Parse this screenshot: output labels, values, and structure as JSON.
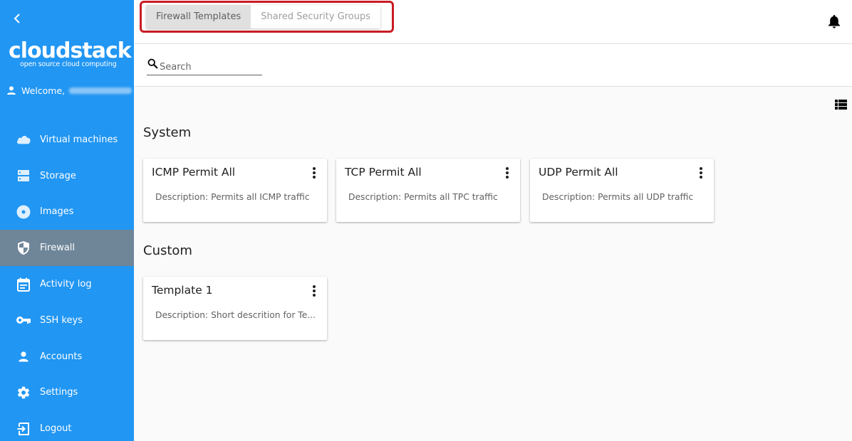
{
  "sidebar": {
    "logo": {
      "name": "cloudstack",
      "tagline": "open source cloud computing"
    },
    "welcome_label": "Welcome,",
    "items": [
      {
        "label": "Virtual machines",
        "icon": "cloud-icon",
        "active": false
      },
      {
        "label": "Storage",
        "icon": "storage-icon",
        "active": false
      },
      {
        "label": "Images",
        "icon": "disc-icon",
        "active": false
      },
      {
        "label": "Firewall",
        "icon": "shield-icon",
        "active": true
      },
      {
        "label": "Activity log",
        "icon": "calendar-icon",
        "active": false
      },
      {
        "label": "SSH keys",
        "icon": "key-icon",
        "active": false
      },
      {
        "label": "Accounts",
        "icon": "person-icon",
        "active": false
      },
      {
        "label": "Settings",
        "icon": "gear-icon",
        "active": false
      },
      {
        "label": "Logout",
        "icon": "logout-icon",
        "active": false
      }
    ]
  },
  "header": {
    "tabs": [
      {
        "label": "Firewall Templates",
        "active": true
      },
      {
        "label": "Shared Security Groups",
        "active": false
      }
    ]
  },
  "search": {
    "placeholder": "Search",
    "value": ""
  },
  "sections": [
    {
      "title": "System",
      "cards": [
        {
          "title": "ICMP Permit All",
          "description": "Description: Permits all ICMP traffic"
        },
        {
          "title": "TCP Permit All",
          "description": "Description: Permits all TPC traffic"
        },
        {
          "title": "UDP Permit All",
          "description": "Description: Permits all UDP traffic"
        }
      ]
    },
    {
      "title": "Custom",
      "cards": [
        {
          "title": "Template 1",
          "description": "Description: Short descrition for Te..."
        }
      ]
    }
  ],
  "colors": {
    "sidebar_bg": "#2196f3",
    "sidebar_active": "#6f8699",
    "highlight_border": "#c91c24",
    "page_bg": "#fafafa"
  }
}
